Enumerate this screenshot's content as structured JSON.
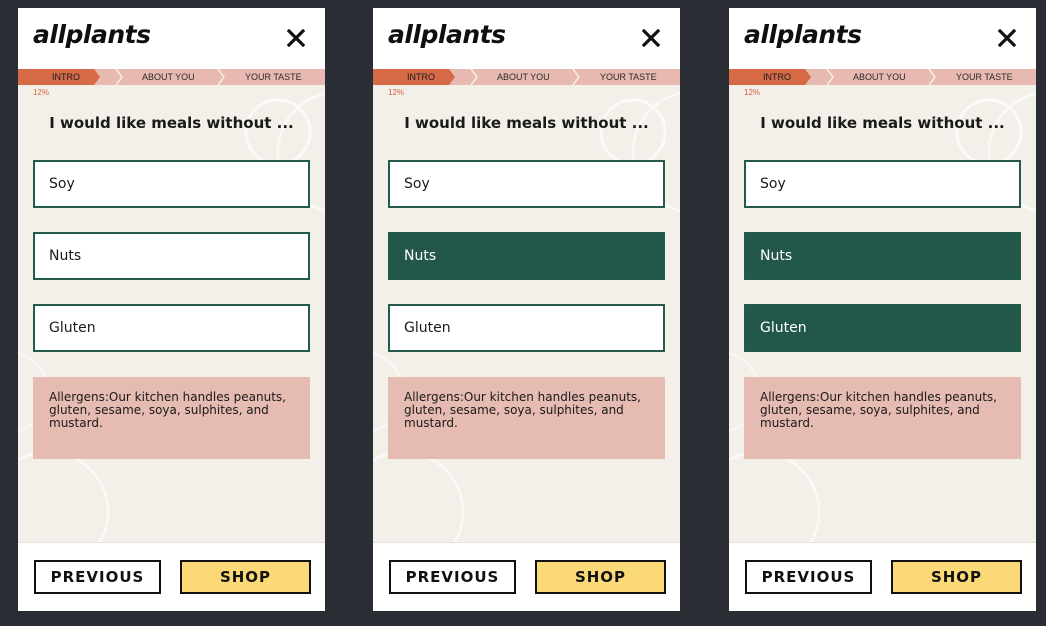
{
  "brand": {
    "logo_text": "allplants"
  },
  "progress": {
    "steps": [
      "INTRO",
      "ABOUT YOU",
      "YOUR TASTE"
    ],
    "percent_label": "12%",
    "percent_value": 12,
    "active_step": 0
  },
  "question": "I would like meals without ...",
  "options": [
    "Soy",
    "Nuts",
    "Gluten"
  ],
  "allergen_note": "Allergens:Our kitchen handles peanuts, gluten, sesame, soya, sulphites, and mustard.",
  "buttons": {
    "previous": "PREVIOUS",
    "shop": "SHOP"
  },
  "screens": [
    {
      "selected": []
    },
    {
      "selected": [
        "Nuts"
      ]
    },
    {
      "selected": [
        "Nuts",
        "Gluten"
      ]
    }
  ],
  "colors": {
    "background": "#2b2d34",
    "page_bg": "#f3efe9",
    "progress_active": "#d66a47",
    "progress_track": "#e8b9b0",
    "option_border": "#245a4c",
    "option_selected": "#23574a",
    "allergen_bg": "#e5bbb2",
    "shop_button": "#fbd977",
    "percent_text": "#d35f3c"
  }
}
